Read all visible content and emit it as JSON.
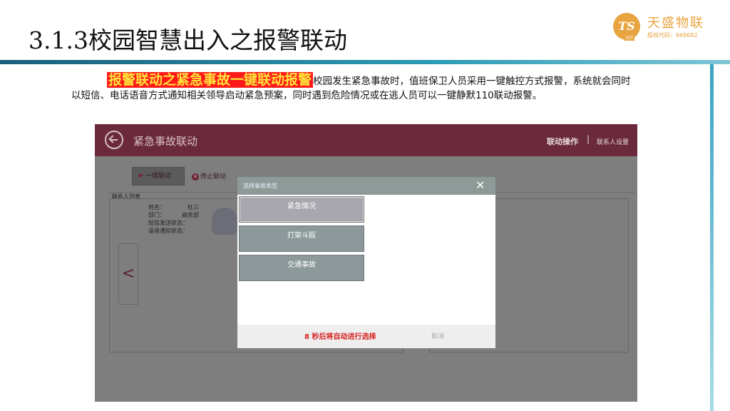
{
  "slide": {
    "title": "3.1.3校园智慧出入之报警联动",
    "highlight": "报警联动之紧急事故一键联动报警",
    "description": "校园发生紧急事故时，值班保卫人员采用一键触控方式报警，系统就会同时以短信、电话语音方式通知相关领导启动紧急预案，同时遇到危险情况或在逃人员可以一键静默110联动报警。"
  },
  "logo": {
    "mark": "TS",
    "mark_sub": "IOT",
    "name": "天盛物联",
    "code": "股权代码：669682",
    "color": "#e8a440"
  },
  "app": {
    "header": {
      "title": "紧急事故联动",
      "action_label": "联动操作",
      "separator": "|",
      "settings_label": "联系人设置",
      "color": "#6a2a3c"
    },
    "toolbar": {
      "onekey_label": "一键联动",
      "onekey_icon": "hand-pointer-icon",
      "stop_label": "停止联动",
      "stop_icon": "close-circle-icon"
    },
    "contacts": {
      "label": "联系人列表",
      "name_label": "姓名：",
      "name_value": "杜三",
      "dept_label": "部门：",
      "dept_value": "商务部",
      "sms_label": "短信发送状态：",
      "voice_label": "语音通知状态："
    },
    "nav_prev": "<"
  },
  "modal": {
    "title": "选择事故类型",
    "close": "✕",
    "options": [
      "紧急情况",
      "打架斗殴",
      "交通事故"
    ],
    "selected_index": 0,
    "countdown": "8 秒后将自动进行选择",
    "cancel": "取消"
  }
}
